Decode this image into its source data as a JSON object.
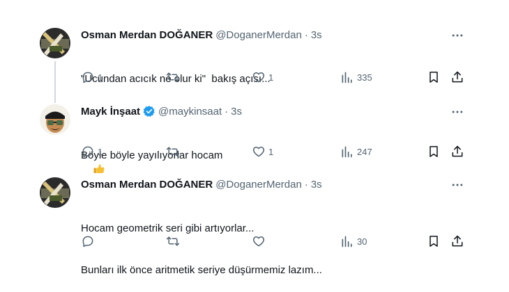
{
  "tweets": [
    {
      "name": "Osman Merdan DOĞANER",
      "handle": "@DoganerMerdan",
      "separator": "·",
      "time": "3s",
      "lines": [
        "\"Ucundan acıcık ne olur ki\"  bakış açısı..."
      ],
      "replies": "1",
      "retweets": "",
      "likes": "1",
      "views": "335"
    },
    {
      "name": "Mayk İnşaat",
      "verified": true,
      "handle": "@maykinsaat",
      "separator": "·",
      "time": "3s",
      "lines": [
        "Böyle böyle yayılıyorlar hocam"
      ],
      "emoji": "thumbs-up-emoji",
      "replies": "1",
      "retweets": "",
      "likes": "1",
      "views": "247"
    },
    {
      "name": "Osman Merdan DOĞANER",
      "handle": "@DoganerMerdan",
      "separator": "·",
      "time": "3s",
      "lines": [
        "Hocam geometrik seri gibi artıyorlar...",
        "Bunları ilk önce aritmetik seriye düşürmemiz lazım..."
      ],
      "replies": "",
      "retweets": "",
      "likes": "",
      "views": "30"
    }
  ],
  "colors": {
    "text": "#0f1419",
    "secondary": "#536471",
    "verified": "#1d9bf0",
    "thread_line": "#cfd9de"
  }
}
